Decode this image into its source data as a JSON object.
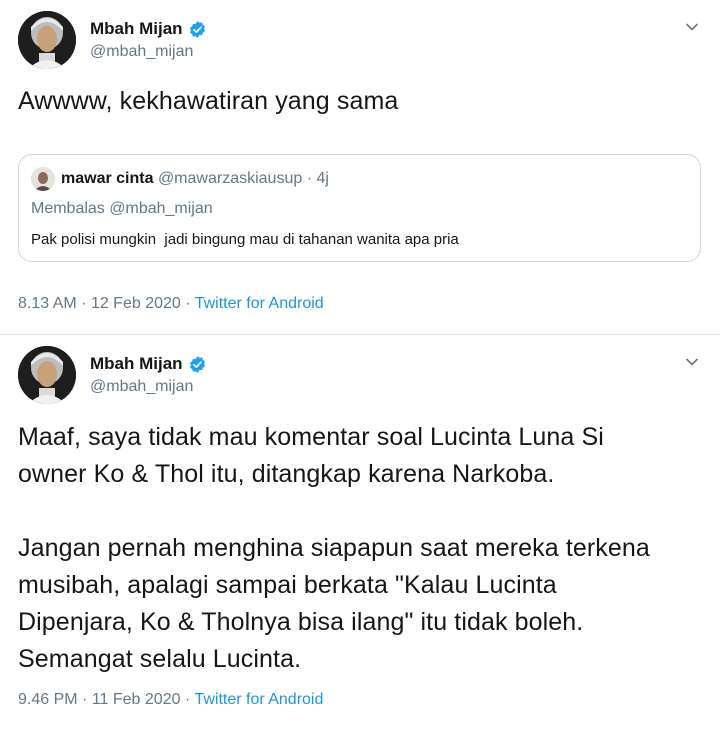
{
  "tweets": [
    {
      "author": {
        "name": "Mbah Mijan",
        "handle": "@mbah_mijan",
        "verified": true
      },
      "text": "Awwww, kekhawatiran yang sama",
      "quoted": {
        "name": "mawar cinta",
        "handle": "@mawarzaskiausup",
        "separator": "·",
        "age": "4j",
        "reply_to": "Membalas @mbah_mijan",
        "text": "Pak polisi mungkin  jadi bingung mau di tahanan wanita apa pria"
      },
      "time": "8.13 AM",
      "date": "12 Feb 2020",
      "separator": "·",
      "source": "Twitter for Android"
    },
    {
      "author": {
        "name": "Mbah Mijan",
        "handle": "@mbah_mijan",
        "verified": true
      },
      "text": "Maaf, saya tidak mau komentar soal Lucinta Luna Si\nowner Ko & Thol itu, ditangkap karena Narkoba.\n\nJangan pernah menghina siapapun saat mereka terkena\nmusibah, apalagi sampai berkata \"Kalau Lucinta\nDipenjara, Ko & Tholnya bisa ilang\" itu tidak boleh.\nSemangat selalu Lucinta.",
      "time": "9.46 PM",
      "date": "11 Feb 2020",
      "separator": "·",
      "source": "Twitter for Android"
    }
  ],
  "colors": {
    "text": "#14171a",
    "secondary": "#657786",
    "link": "#1b95e0",
    "verified": "#1da1f2",
    "border": "#e1e8ed"
  },
  "icons": {
    "verified": "verified-badge-icon",
    "caret": "chevron-down-icon"
  }
}
